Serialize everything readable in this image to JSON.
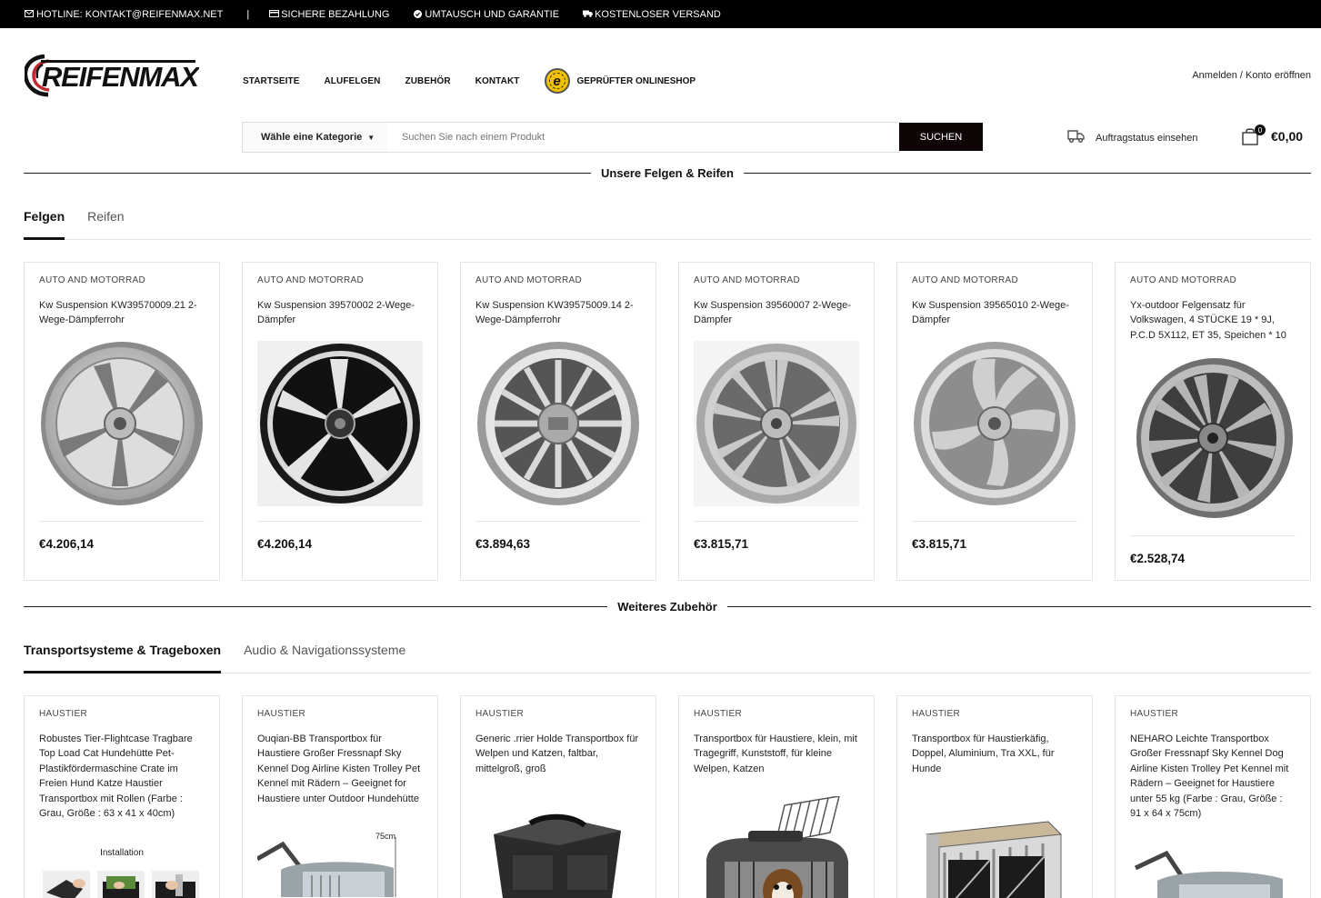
{
  "topbar": {
    "hotline": "HOTLINE: KONTAKT@REIFENMAX.NET",
    "separator": "|",
    "secure_payment": "SICHERE BEZAHLUNG",
    "exchange": "UMTAUSCH UND GARANTIE",
    "shipping": "KOSTENLOSER VERSAND"
  },
  "header": {
    "logo_text": "REIFENMAX",
    "nav": [
      "STARTSEITE",
      "ALUFELGEN",
      "ZUBEHÖR",
      "KONTAKT"
    ],
    "trust_label": "GEPRÜFTER ONLINESHOP",
    "trust_badge_letter": "e",
    "account": "Anmelden / Konto eröffnen"
  },
  "search": {
    "category_label": "Wähle eine Kategorie",
    "placeholder": "Suchen Sie nach einem Produkt",
    "button": "SUCHEN"
  },
  "orderstatus": {
    "label": "Auftragstatus einsehen"
  },
  "cart": {
    "count": "0",
    "total": "€0,00"
  },
  "section1": {
    "title": "Unsere Felgen & Reifen",
    "tabs": [
      "Felgen",
      "Reifen"
    ],
    "products": [
      {
        "category": "AUTO AND MOTORRAD",
        "title": "Kw Suspension KW39570009.21 2-Wege-Dämpferrohr",
        "price": "€4.206,14",
        "style": "silver-twin"
      },
      {
        "category": "AUTO AND MOTORRAD",
        "title": "Kw Suspension 39570002 2-Wege-Dämpfer",
        "price": "€4.206,14",
        "style": "black-polished"
      },
      {
        "category": "AUTO AND MOTORRAD",
        "title": "Kw Suspension KW39575009.14 2-Wege-Dämpferrohr",
        "price": "€3.894,63",
        "style": "multi-spoke"
      },
      {
        "category": "AUTO AND MOTORRAD",
        "title": "Kw Suspension 39560007 2-Wege-Dämpfer",
        "price": "€3.815,71",
        "style": "silver-split"
      },
      {
        "category": "AUTO AND MOTORRAD",
        "title": "Kw Suspension 39565010 2-Wege-Dämpfer",
        "price": "€3.815,71",
        "style": "rotor"
      },
      {
        "category": "AUTO AND MOTORRAD",
        "title": "Yx-outdoor Felgensatz für Volkswagen, 4 STÜCKE 19 * 9J, P.C.D 5X112, ET 35, Speichen * 10",
        "price": "€2.528,74",
        "style": "gunmetal"
      }
    ]
  },
  "section2": {
    "title": "Weiteres Zubehör",
    "tabs": [
      "Transportsysteme & Trageboxen",
      "Audio & Navigationssysteme"
    ],
    "products": [
      {
        "category": "HAUSTIER",
        "title": "Robustes Tier-Flightcase Tragbare Top Load Cat Hundehütte Pet-Plastikfördermaschine Crate im Freien Hund Katze Haustier Transportbox mit Rollen (Farbe : Grau, Größe : 63 x 41 x 40cm)",
        "image_caption": "Installation"
      },
      {
        "category": "HAUSTIER",
        "title": "Ouqian-BB Transportbox für Haustiere Großer Fressnapf Sky Kennel Dog Airline Kisten Trolley Pet Kennel mit Rädern – Geeignet for Haustiere unter Outdoor Hundehütte",
        "image_caption": "75cm"
      },
      {
        "category": "HAUSTIER",
        "title": "Generic .rrier Holde Transportbox für Welpen und Katzen, faltbar, mittelgroß, groß",
        "image_caption": ""
      },
      {
        "category": "HAUSTIER",
        "title": "Transportbox für Haustiere, klein, mit Tragegriff, Kunststoff, für kleine Welpen, Katzen",
        "image_caption": ""
      },
      {
        "category": "HAUSTIER",
        "title": "Transportbox für Haustierkäfig, Doppel, Aluminium, Tra XXL, für Hunde",
        "image_caption": ""
      },
      {
        "category": "HAUSTIER",
        "title": "NEHARO Leichte Transportbox Großer Fressnapf Sky Kennel Dog Airline Kisten Trolley Pet Kennel mit Rädern – Geeignet for Haustiere unter 55 kg (Farbe : Grau, Größe : 91 x 64 x 75cm)",
        "image_caption": ""
      }
    ]
  }
}
